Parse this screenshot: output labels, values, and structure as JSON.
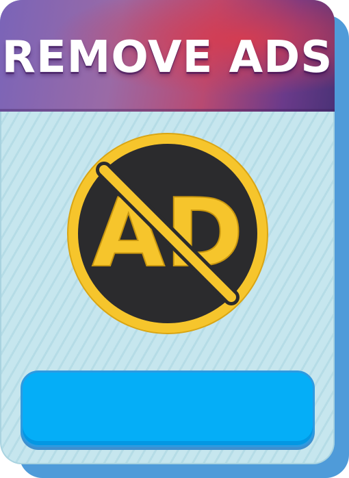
{
  "header": {
    "title": "REMOVE ADS"
  },
  "icon": {
    "name": "no-ads-icon",
    "text": "AD"
  },
  "buy_button": {
    "label": ""
  },
  "colors": {
    "card_back": "#4f9bd9",
    "card_face": "#c6e6ee",
    "header_start": "#7a64b8",
    "header_mid": "#b84a72",
    "header_end": "#4b3277",
    "icon_ring": "#f6c52c",
    "icon_fill": "#2b2b2d",
    "button": "#05aef7"
  }
}
